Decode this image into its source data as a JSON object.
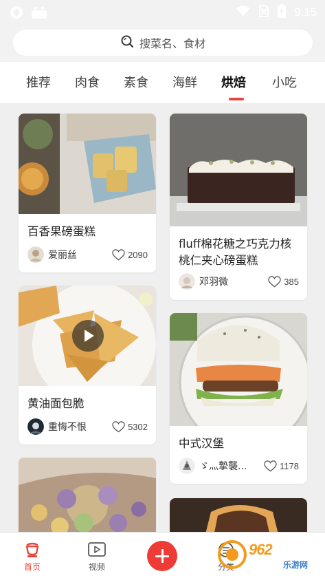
{
  "status_bar": {
    "time": "9:15",
    "icons": [
      "app-icon",
      "android-robot-icon",
      "wifi-icon",
      "no-sim-icon",
      "battery-icon"
    ]
  },
  "search": {
    "placeholder": "搜菜名、食材",
    "icon": "search-icon"
  },
  "tabs": [
    {
      "label": "推荐",
      "active": false
    },
    {
      "label": "肉食",
      "active": false
    },
    {
      "label": "素食",
      "active": false
    },
    {
      "label": "海鲜",
      "active": false
    },
    {
      "label": "烘焙",
      "active": true
    },
    {
      "label": "小吃",
      "active": false
    }
  ],
  "cards": [
    {
      "title": "百香果磅蛋糕",
      "author": "爱丽丝",
      "likes": "2090",
      "video": false
    },
    {
      "title": "fluff棉花糖之巧克力核桃仁夹心磅蛋糕",
      "author": "邓羽微",
      "likes": "385",
      "video": false
    },
    {
      "title": "黄油面包脆",
      "author": "重悔不恨",
      "likes": "5302",
      "video": true
    },
    {
      "title": "中式汉堡",
      "author": "ゞ灬摯襲...",
      "likes": "1178",
      "video": false
    },
    {
      "title": "",
      "author": "",
      "likes": "",
      "video": false
    },
    {
      "title": "",
      "author": "",
      "likes": "",
      "video": false
    }
  ],
  "bottom_nav": {
    "items": [
      {
        "label": "首页",
        "icon": "chef-hat-icon",
        "active": true
      },
      {
        "label": "视频",
        "icon": "video-play-icon",
        "active": false
      },
      {
        "label": "",
        "icon": "add-icon",
        "active": false
      },
      {
        "label": "分类",
        "icon": "category-icon",
        "active": false
      }
    ]
  },
  "watermark": {
    "main": "962",
    "sub": "乐游网"
  },
  "colors": {
    "accent": "#e8453c",
    "add_button": "#ee3b36",
    "background": "#f2f2f2"
  }
}
